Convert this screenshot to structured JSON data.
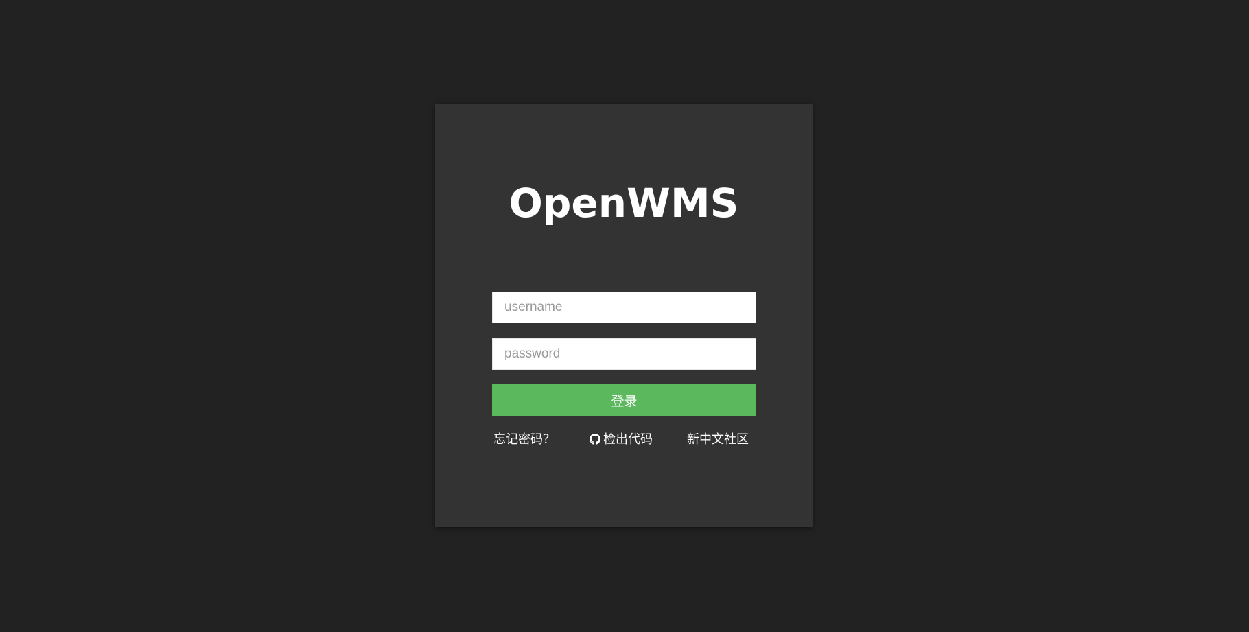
{
  "login": {
    "title": "OpenWMS",
    "username_placeholder": "username",
    "password_placeholder": "password",
    "submit_label": "登录"
  },
  "links": {
    "forgot_password": "忘记密码？",
    "checkout_code": "检出代码",
    "community": "新中文社区",
    "checkout_icon": "github-icon"
  },
  "colors": {
    "background": "#222222",
    "card": "#333333",
    "accent": "#5cb85c",
    "text": "#ffffff"
  }
}
